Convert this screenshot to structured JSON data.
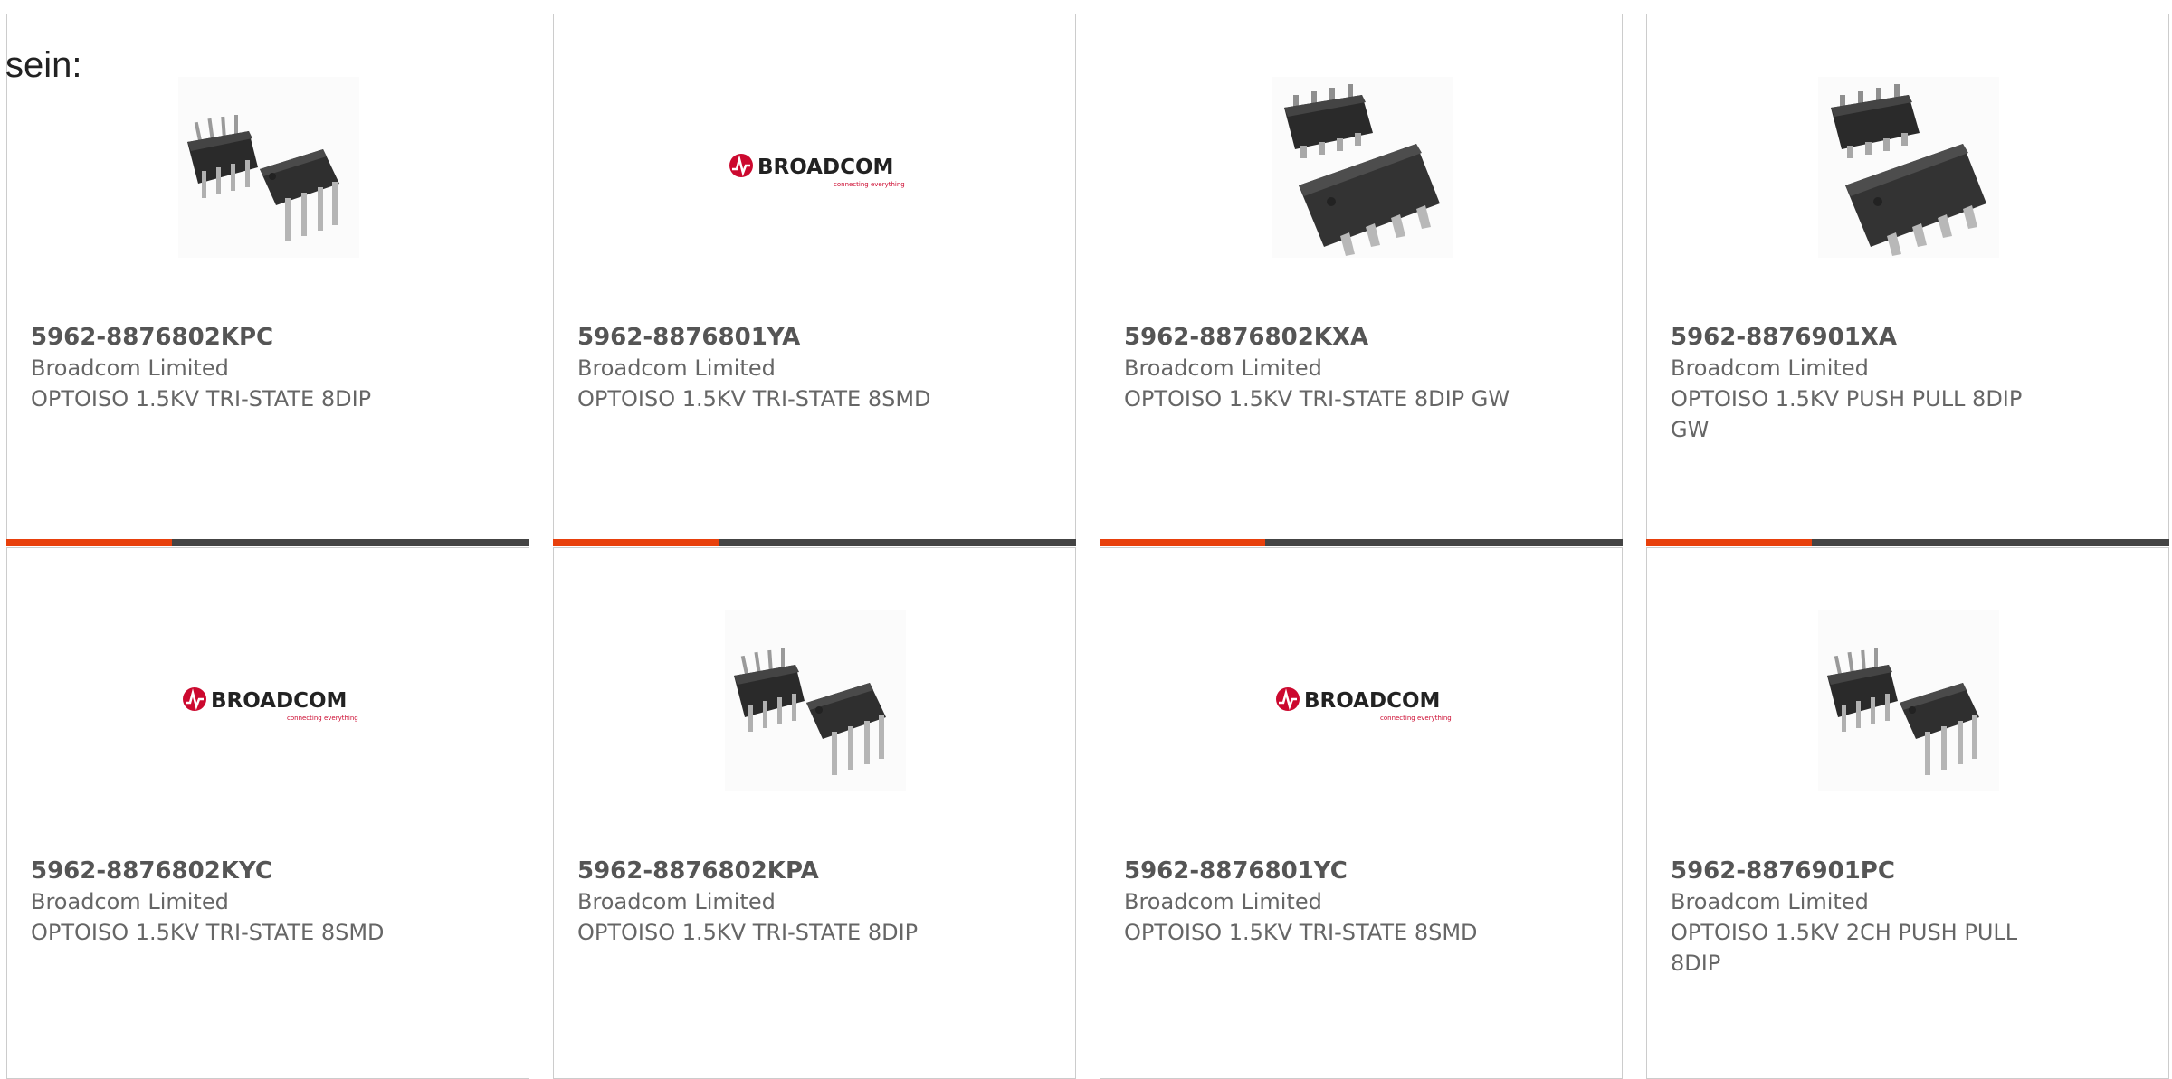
{
  "intro_text": "sein:",
  "colors": {
    "accent": "#e8400c",
    "bar": "#444444",
    "card_border": "#cccccc",
    "brand_red": "#cc092f"
  },
  "cards": [
    {
      "part_number": "5962-8876802KPC",
      "manufacturer": "Broadcom Limited",
      "description": "OPTOISO 1.5KV TRI-STATE 8DIP",
      "image": "dip-8-chip-photo"
    },
    {
      "part_number": "5962-8876801YA",
      "manufacturer": "Broadcom Limited",
      "description": "OPTOISO 1.5KV TRI-STATE 8SMD",
      "image": "broadcom-logo"
    },
    {
      "part_number": "5962-8876802KXA",
      "manufacturer": "Broadcom Limited",
      "description": "OPTOISO 1.5KV TRI-STATE 8DIP GW",
      "image": "smd-8-chip-photo"
    },
    {
      "part_number": "5962-8876901XA",
      "manufacturer": "Broadcom Limited",
      "description": "OPTOISO 1.5KV PUSH PULL 8DIP GW",
      "image": "smd-8-chip-photo"
    },
    {
      "part_number": "5962-8876802KYC",
      "manufacturer": "Broadcom Limited",
      "description": "OPTOISO 1.5KV TRI-STATE 8SMD",
      "image": "broadcom-logo"
    },
    {
      "part_number": "5962-8876802KPA",
      "manufacturer": "Broadcom Limited",
      "description": "OPTOISO 1.5KV TRI-STATE 8DIP",
      "image": "dip-8-chip-photo"
    },
    {
      "part_number": "5962-8876801YC",
      "manufacturer": "Broadcom Limited",
      "description": "OPTOISO 1.5KV TRI-STATE 8SMD",
      "image": "broadcom-logo"
    },
    {
      "part_number": "5962-8876901PC",
      "manufacturer": "Broadcom Limited",
      "description": "OPTOISO 1.5KV 2CH PUSH PULL 8DIP",
      "image": "dip-8-chip-photo"
    }
  ],
  "brand_logo": {
    "name": "BROADCOM",
    "tagline": "connecting everything"
  }
}
